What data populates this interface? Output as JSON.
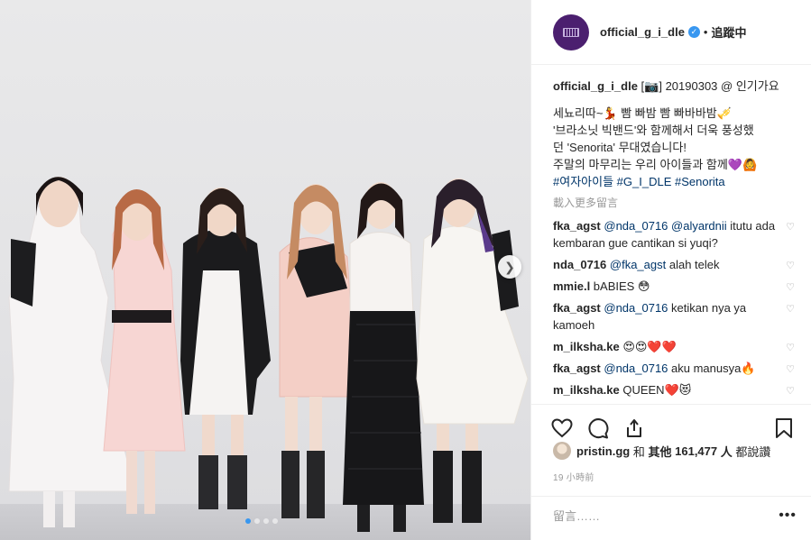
{
  "post_image": {
    "alt_colors": {
      "wall": "#e6e6e8",
      "floor": "#c8c8cc"
    },
    "carousel": {
      "current": 1,
      "total": 4
    },
    "next_icon": "chevron-right-icon"
  },
  "header": {
    "username": "official_g_i_dle",
    "verified_mark": "✓",
    "separator": "•",
    "follow_state": "追蹤中"
  },
  "caption": {
    "username": "official_g_i_dle",
    "line1": "[📷] 20190303 @ 인기가요",
    "line2": "세뇨리따~💃 빰 빠밤 빰 빠바바밤🎺",
    "line3": "'브라소닛 빅밴드'와 함께해서 더욱 풍성했",
    "line4": "던 'Senorita' 무대였습니다!",
    "line5": "주말의 마무리는 우리 아이들과 함께💜🙆",
    "hashtags": [
      "#여자아이들",
      "#G_I_DLE",
      "#Senorita"
    ]
  },
  "load_more": "載入更多留言",
  "comments": [
    {
      "user": "fka_agst",
      "mention": "@nda_0716 @alyardnii",
      "text": " itutu ada kembaran gue cantikan si yuqi?"
    },
    {
      "user": "nda_0716",
      "mention": "@fka_agst",
      "text": " alah telek"
    },
    {
      "user": "mmie.l",
      "mention": "",
      "text": " bABIES 😳"
    },
    {
      "user": "fka_agst",
      "mention": "@nda_0716",
      "text": " ketikan nya ya kamoeh"
    },
    {
      "user": "m_ilksha.ke",
      "mention": "",
      "text": " 😍😍❤️❤️"
    },
    {
      "user": "fka_agst",
      "mention": "@nda_0716",
      "text": " aku manusya🔥"
    },
    {
      "user": "m_ilksha.ke",
      "mention": "",
      "text": " QUEEN❤️😻"
    }
  ],
  "likes": {
    "first_user": "pristin.gg",
    "and": "和",
    "others_prefix": "其他",
    "count": "161,477",
    "others_suffix": "人",
    "verb": "都說讚"
  },
  "timestamp": "19 小時前",
  "add_comment": {
    "placeholder": "留言……",
    "more": "•••"
  },
  "colors": {
    "accent": "#3897f0",
    "hashtag": "#003569",
    "muted": "#999999"
  }
}
